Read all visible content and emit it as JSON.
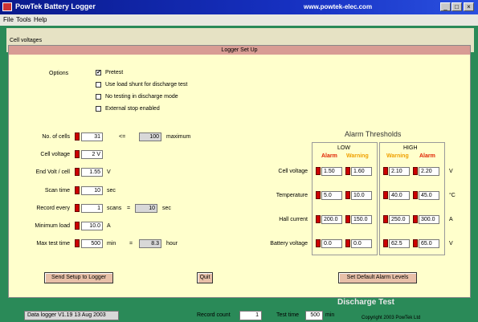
{
  "window": {
    "title": "PowTek Battery Logger",
    "site": "www.powtek-elec.com",
    "min_label": "_",
    "max_label": "□",
    "close_label": "×"
  },
  "menu": {
    "file": "File",
    "tools": "Tools",
    "help": "Help"
  },
  "background": {
    "graph_label": "Cell voltages"
  },
  "dialog": {
    "title": "Logger Set Up",
    "options_label": "Options",
    "options": [
      {
        "label": "Pretest",
        "checked": true,
        "mark": "✔"
      },
      {
        "label": "Use load shunt for discharge test",
        "checked": false,
        "mark": ""
      },
      {
        "label": "No testing in discharge mode",
        "checked": false,
        "mark": ""
      },
      {
        "label": "External stop enabled",
        "checked": false,
        "mark": ""
      }
    ],
    "cells": {
      "label": "No. of cells",
      "value": "31",
      "le": "<=",
      "max_value": "100",
      "max_label": "maximum"
    },
    "cell_voltage": {
      "label": "Cell voltage",
      "value": "2 V"
    },
    "end_volt": {
      "label": "End Volt / cell",
      "value": "1.55",
      "unit": "V"
    },
    "scan_time": {
      "label": "Scan time",
      "value": "10",
      "unit": "sec"
    },
    "record_every": {
      "label": "Record every",
      "value": "1",
      "unit1": "scans",
      "eq": "=",
      "value2": "10",
      "unit2": "sec"
    },
    "min_load": {
      "label": "Minimum load",
      "value": "10.0",
      "unit": "A"
    },
    "max_test": {
      "label": "Max test time",
      "value": "500",
      "unit1": "min",
      "eq": "=",
      "value2": "8.3",
      "unit2": "hour"
    },
    "alarm": {
      "title": "Alarm Thresholds",
      "low_label": "LOW",
      "high_label": "HIGH",
      "alarm_label": "Alarm",
      "warning_label": "Warning",
      "alarm_color": "#e02000",
      "warning_color": "#f0a000",
      "rows": [
        {
          "label": "Cell voltage",
          "low_alarm": "1.50",
          "low_warning": "1.60",
          "high_warning": "2.10",
          "high_alarm": "2.20",
          "unit": "V"
        },
        {
          "label": "Temperature",
          "low_alarm": "5.0",
          "low_warning": "10.0",
          "high_warning": "40.0",
          "high_alarm": "45.0",
          "unit": "°C"
        },
        {
          "label": "Hall current",
          "low_alarm": "200.0",
          "low_warning": "150.0",
          "high_warning": "250.0",
          "high_alarm": "300.0",
          "unit": "A"
        },
        {
          "label": "Battery voltage",
          "low_alarm": "0.0",
          "low_warning": "0.0",
          "high_warning": "62.5",
          "high_alarm": "65.0",
          "unit": "V"
        }
      ]
    },
    "buttons": {
      "send": "Send Setup to Logger",
      "quit": "Quit",
      "defaults": "Set Default Alarm Levels"
    }
  },
  "status": {
    "version": "Data logger V1.19 13 Aug 2003",
    "record_count_label": "Record count",
    "record_count": "1",
    "test_time_label": "Test time",
    "test_time": "500",
    "test_time_unit": "min",
    "copyright": "Copyright 2003 PowTek Ltd",
    "behind_text": "Discharge Test"
  }
}
